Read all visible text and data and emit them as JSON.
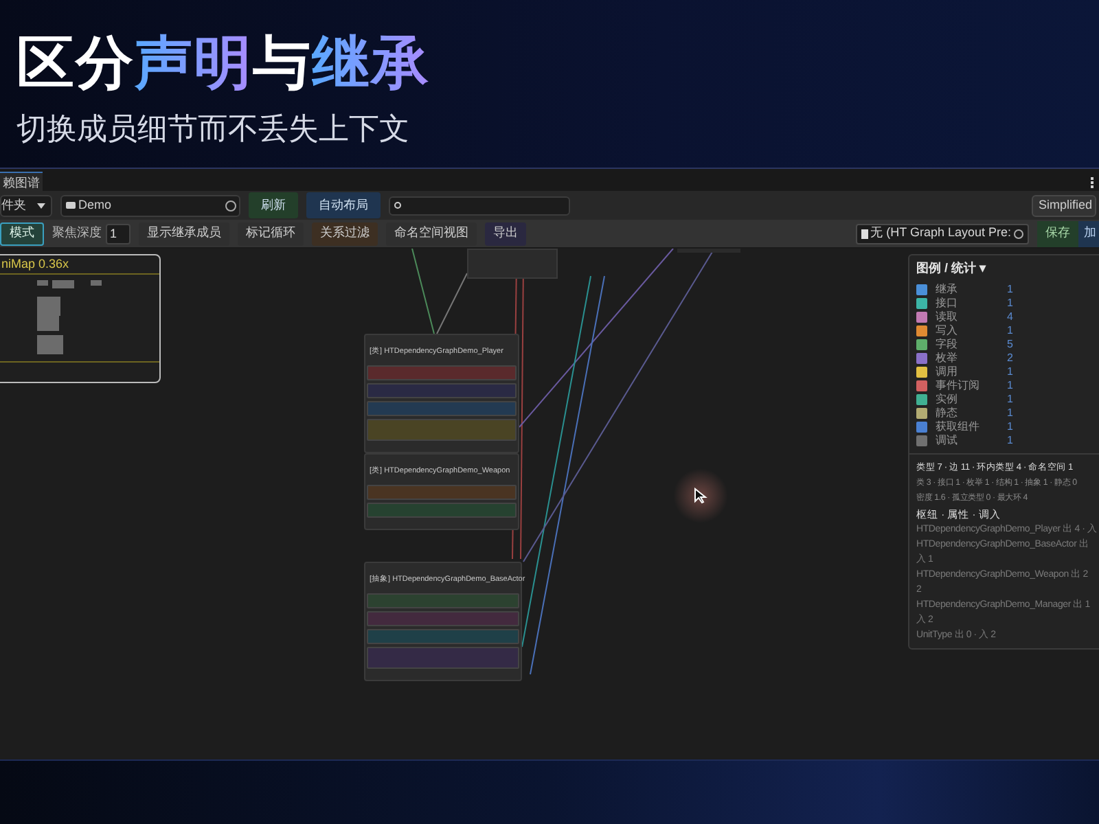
{
  "headline": {
    "title_parts": [
      {
        "text": "区分",
        "highlight": false
      },
      {
        "text": "声明",
        "highlight": true
      },
      {
        "text": "与",
        "highlight": false
      },
      {
        "text": "继承",
        "highlight": true
      }
    ],
    "subtitle": "切换成员细节而不丢失上下文"
  },
  "window": {
    "tab": "赖图谱",
    "toolbar": {
      "dropdown": "件夹",
      "path_field": "Demo",
      "buttons": [
        {
          "label": "刷新",
          "color": "#233f2a"
        },
        {
          "label": "自动布局",
          "color": "#1f3550"
        }
      ],
      "mode_dropdown": "Simplified"
    },
    "toolbar2": [
      {
        "kind": "button",
        "label": "模式",
        "selected": true,
        "color": "#24423a"
      },
      {
        "kind": "label",
        "label": "聚焦深度"
      },
      {
        "kind": "number",
        "label": "1"
      },
      {
        "kind": "button",
        "label": "显示继承成员",
        "selected": false,
        "color": "#2f2f2f"
      },
      {
        "kind": "button",
        "label": "标记循环",
        "selected": false,
        "color": "#2f2f2f"
      },
      {
        "kind": "button",
        "label": "关系过滤",
        "selected": false,
        "color": "#3d2f22"
      },
      {
        "kind": "button",
        "label": "命名空间视图",
        "selected": false,
        "color": "#2f2f2f"
      },
      {
        "kind": "button",
        "label": "导出",
        "selected": false,
        "color": "#2a2840"
      }
    ],
    "layout_field": "无 (HT Graph Layout Pre:",
    "save_button": "保存",
    "load_button": "加",
    "minimap": {
      "title": "niMap  0.36x"
    },
    "nodes": [
      {
        "title": "[类] HTDependencyGraphDemo_Player",
        "rows": [
          {
            "color": "#5a2a2c"
          },
          {
            "color": "#2a2a44"
          },
          {
            "color": "#233a52"
          },
          {
            "color": "#4a4424"
          }
        ]
      },
      {
        "title": "[类] HTDependencyGraphDemo_Weapon",
        "rows": [
          {
            "color": "#4a3422"
          },
          {
            "color": "#264230"
          }
        ]
      },
      {
        "title": "[抽象] HTDependencyGraphDemo_BaseActor",
        "rows": [
          {
            "color": "#2c4230"
          },
          {
            "color": "#432a3e"
          },
          {
            "color": "#1f4048"
          },
          {
            "color": "#342a46"
          }
        ]
      }
    ],
    "legend": {
      "title": "图例 / 统计 ▾",
      "items": [
        {
          "label": "继承",
          "count": "1",
          "color": "#4a8fd8"
        },
        {
          "label": "接口",
          "count": "1",
          "color": "#3cb4a6"
        },
        {
          "label": "读取",
          "count": "4",
          "color": "#c27ab2"
        },
        {
          "label": "写入",
          "count": "1",
          "color": "#e08a32"
        },
        {
          "label": "字段",
          "count": "5",
          "color": "#5eae6a"
        },
        {
          "label": "枚举",
          "count": "2",
          "color": "#8a70c8"
        },
        {
          "label": "调用",
          "count": "1",
          "color": "#e2c042"
        },
        {
          "label": "事件订阅",
          "count": "1",
          "color": "#d26060"
        },
        {
          "label": "实例",
          "count": "1",
          "color": "#40b092"
        },
        {
          "label": "静态",
          "count": "1",
          "color": "#b2ab72"
        },
        {
          "label": "获取组件",
          "count": "1",
          "color": "#4a80d2"
        },
        {
          "label": "调试",
          "count": "1",
          "color": "#707070"
        }
      ],
      "summary": "类型 7 · 边 11 · 环内类型 4 · 命名空间 1",
      "details": [
        "类 3 · 接口 1 · 枚举 1 · 结构 1 · 抽象 1 · 静态 0",
        "密度 1.6 · 孤立类型 0 · 最大环 4"
      ],
      "hub_heading": "枢纽 · 属性 · 调入",
      "hubs": [
        "HTDependencyGraphDemo_Player 出 4 · 入",
        "HTDependencyGraphDemo_BaseActor 出",
        "入 1",
        "HTDependencyGraphDemo_Weapon 出 2",
        "2",
        "HTDependencyGraphDemo_Manager 出 1",
        "入 2",
        "UnitType 出 0 · 入 2"
      ]
    }
  }
}
